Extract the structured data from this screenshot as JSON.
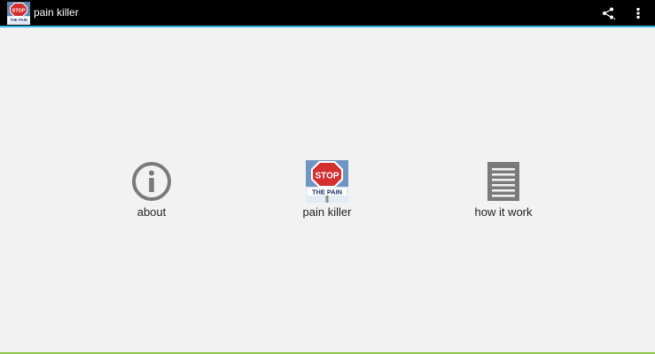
{
  "actionbar": {
    "title": "pain killer",
    "app_icon": "stop-the-pain-icon",
    "actions": [
      {
        "name": "share",
        "icon": "share-icon"
      },
      {
        "name": "overflow",
        "icon": "overflow-menu-icon"
      }
    ]
  },
  "app_icon_text": {
    "stop": "STOP",
    "the_pain": "THE PAIN"
  },
  "tiles": [
    {
      "label": "about",
      "icon": "info-icon"
    },
    {
      "label": "pain killer",
      "icon": "stop-the-pain-icon"
    },
    {
      "label": "how it work",
      "icon": "document-lines-icon"
    }
  ],
  "colors": {
    "actionbar_bg": "#000000",
    "actionbar_accent": "#33b5e5",
    "background": "#f2f2f2",
    "stop_red": "#d32f2f",
    "icon_gray": "#7a7a7a"
  }
}
